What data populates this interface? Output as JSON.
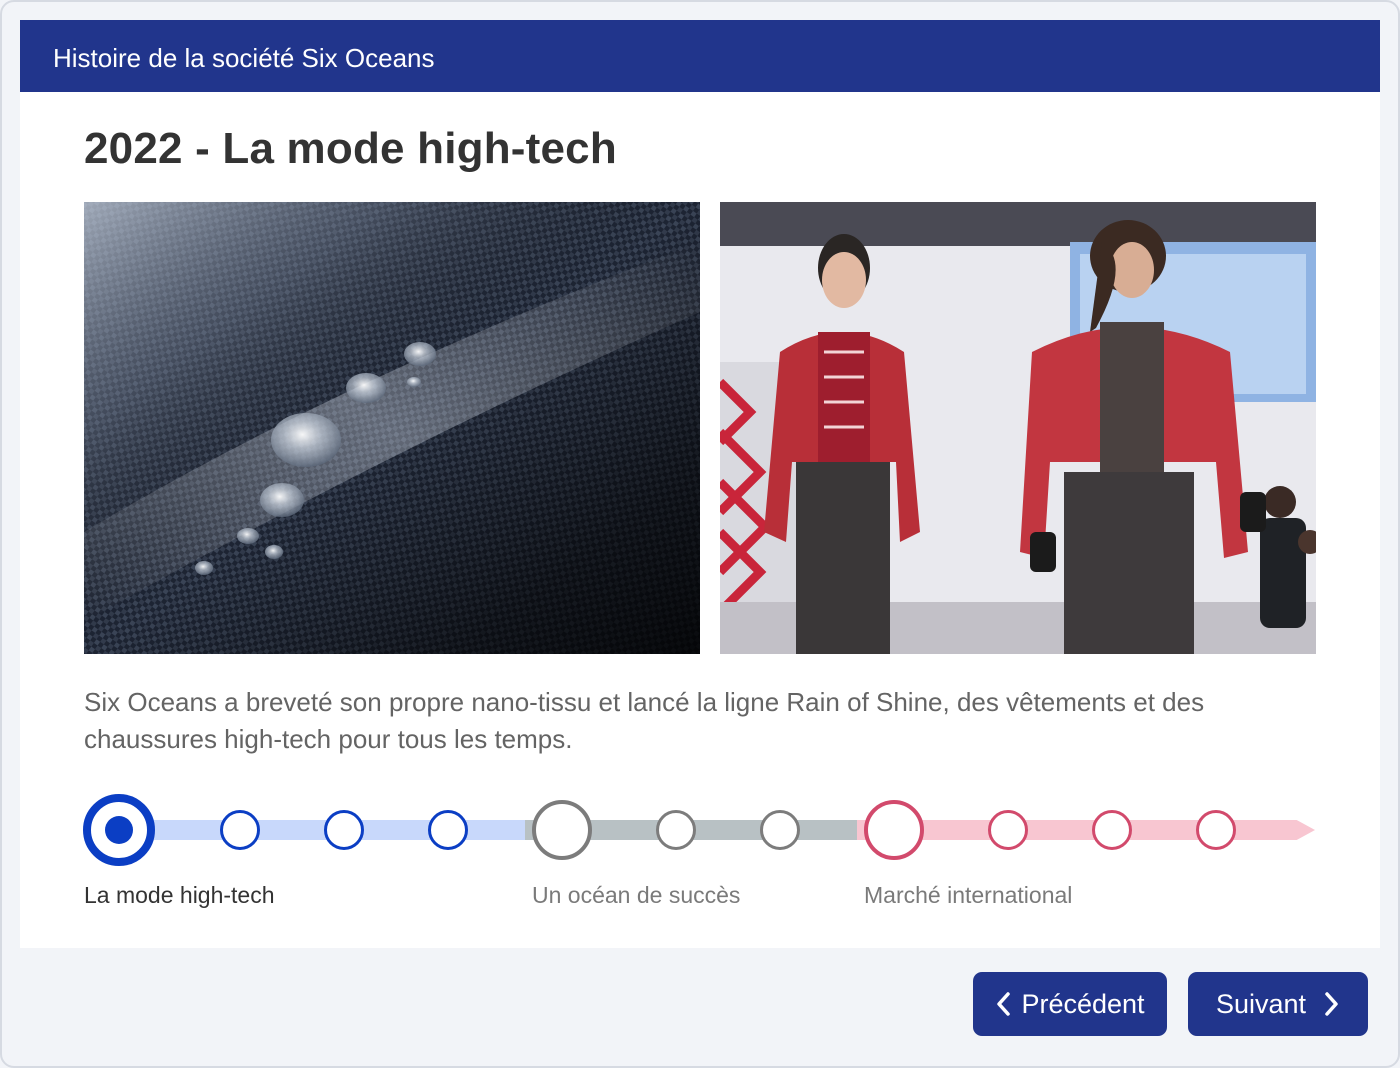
{
  "header": {
    "title": "Histoire de la société Six Oceans"
  },
  "slide": {
    "title": "2022 - La mode high-tech",
    "description": "Six Oceans a breveté son propre nano-tissu et lancé la ligne Rain of Shine, des vêtements et des chaussures high-tech pour tous les temps."
  },
  "images": {
    "left": {
      "subject": "water-drops-on-carbon-fabric"
    },
    "right": {
      "subject": "runway-models-red-jackets"
    }
  },
  "timeline": {
    "current_index": 0,
    "groups": [
      {
        "label": "La mode high-tech",
        "color": "#0b3ec4",
        "track": "#c8d8fb",
        "steps": 4,
        "active": true
      },
      {
        "label": "Un océan de succès",
        "color": "#7c7c7c",
        "track": "#b8c1c4",
        "steps": 3,
        "active": false
      },
      {
        "label": "Marché international",
        "color": "#d24a6c",
        "track": "#f8c6d1",
        "steps": 4,
        "active": false
      }
    ]
  },
  "nav": {
    "prev_label": "Précédent",
    "next_label": "Suivant"
  },
  "colors": {
    "brand": "#21358c",
    "title": "#333333",
    "body_text": "#646464"
  },
  "icons": {
    "prev": "chevron-left-icon",
    "next": "chevron-right-icon"
  }
}
